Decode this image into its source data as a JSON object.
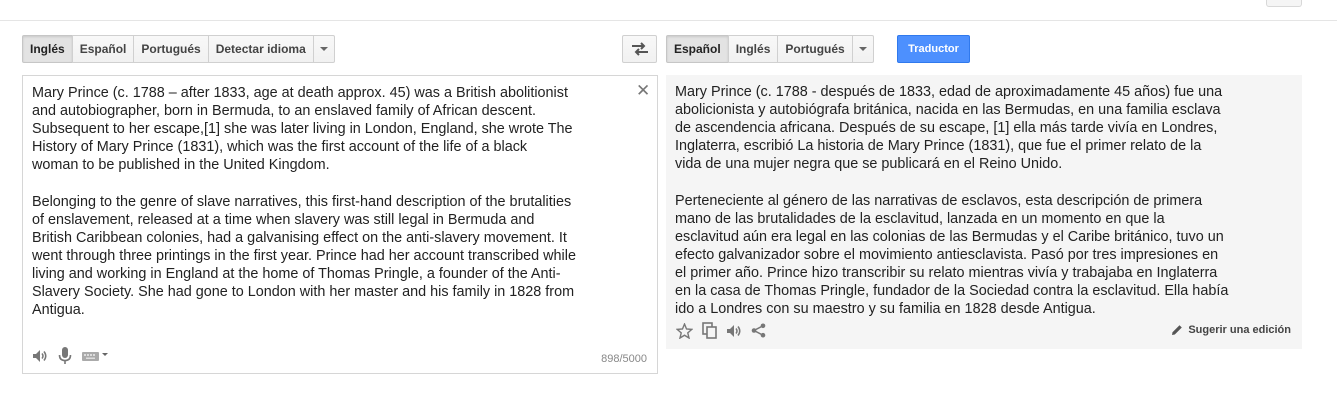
{
  "source_langs": [
    {
      "label": "Inglés",
      "selected": true
    },
    {
      "label": "Español",
      "selected": false
    },
    {
      "label": "Portugués",
      "selected": false
    },
    {
      "label": "Detectar idioma",
      "selected": false
    }
  ],
  "target_langs": [
    {
      "label": "Español",
      "selected": true
    },
    {
      "label": "Inglés",
      "selected": false
    },
    {
      "label": "Portugués",
      "selected": false
    }
  ],
  "translate_button": "Traductor",
  "source": {
    "text": "Mary Prince (c. 1788 – after 1833, age at death approx. 45) was a British abolitionist\nand autobiographer, born in Bermuda, to an enslaved family of African descent.\nSubsequent to her escape,[1] she was later living in London, England, she wrote The\nHistory of Mary Prince (1831), which was the first account of the life of a black\nwoman to be published in the United Kingdom.\n\nBelonging to the genre of slave narratives, this first-hand description of the brutalities\nof enslavement, released at a time when slavery was still legal in Bermuda and\nBritish Caribbean colonies, had a galvanising effect on the anti-slavery movement. It\nwent through three printings in the first year. Prince had her account transcribed while\nliving and working in England at the home of Thomas Pringle, a founder of the Anti-\nSlavery Society. She had gone to London with her master and his family in 1828 from\nAntigua.",
    "char_count": "898/5000"
  },
  "target": {
    "text": "Mary Prince (c. 1788 - después de 1833, edad de aproximadamente 45 años) fue una\nabolicionista y autobiógrafa británica, nacida en las Bermudas, en una familia esclava\nde ascendencia africana. Después de su escape, [1] ella más tarde vivía en Londres,\nInglaterra, escribió La historia de Mary Prince (1831), que fue el primer relato de la\nvida de una mujer negra que se publicará en el Reino Unido.\n\nPerteneciente al género de las narrativas de esclavos, esta descripción de primera\nmano de las brutalidades de la esclavitud, lanzada en un momento en que la\nesclavitud aún era legal en las colonias de las Bermudas y el Caribe británico, tuvo un\nefecto galvanizador sobre el movimiento antiesclavista. Pasó por tres impresiones en\nel primer año. Prince hizo transcribir su relato mientras vivía y trabajaba en Inglaterra\nen la casa de Thomas Pringle, fundador de la Sociedad contra la esclavitud. Ella había\nido a Londres con su maestro y su familia en 1828 desde Antigua.",
    "suggest_edit": "Sugerir una edición"
  },
  "colors": {
    "accent": "#4d90fe",
    "target_bg": "#f5f5f5",
    "icon": "#777777"
  },
  "icons": [
    "swap-icon",
    "close-icon",
    "speaker-icon",
    "microphone-icon",
    "keyboard-icon",
    "star-icon",
    "copy-icon",
    "share-icon",
    "pencil-icon"
  ]
}
